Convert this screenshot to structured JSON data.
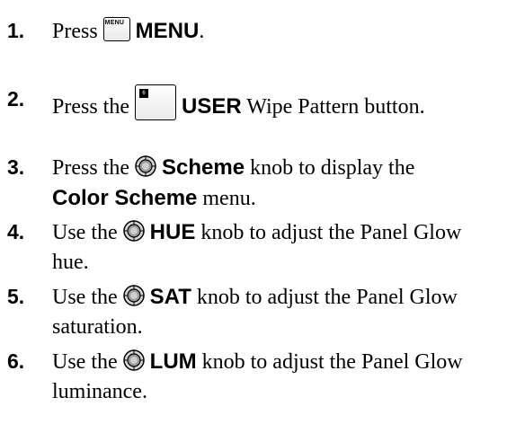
{
  "steps": [
    {
      "number": "1.",
      "before": "Press ",
      "icon": "menu-button-icon",
      "icon_text": "MENU",
      "bold": "MENU",
      "after": "."
    },
    {
      "number": "2.",
      "before": "Press the ",
      "icon": "user-wipe-button-icon",
      "icon_text": "6",
      "bold": "USER",
      "after": " Wipe Pattern button."
    },
    {
      "number": "3.",
      "before": "Press the ",
      "icon": "knob-icon",
      "bold": "Scheme",
      "after": " knob to display the",
      "line2_bold": "Color Scheme",
      "line2_after": " menu."
    },
    {
      "number": "4.",
      "before": "Use the ",
      "icon": "knob-icon",
      "bold": "HUE",
      "after": " knob to adjust the Panel Glow",
      "line2": "hue."
    },
    {
      "number": "5.",
      "before": "Use the ",
      "icon": "knob-icon",
      "bold": "SAT",
      "after": " knob to adjust the Panel Glow",
      "line2": "saturation."
    },
    {
      "number": "6.",
      "before": "Use the ",
      "icon": "knob-icon",
      "bold": "LUM",
      "after": " knob to adjust the Panel Glow",
      "line2": "luminance."
    }
  ]
}
